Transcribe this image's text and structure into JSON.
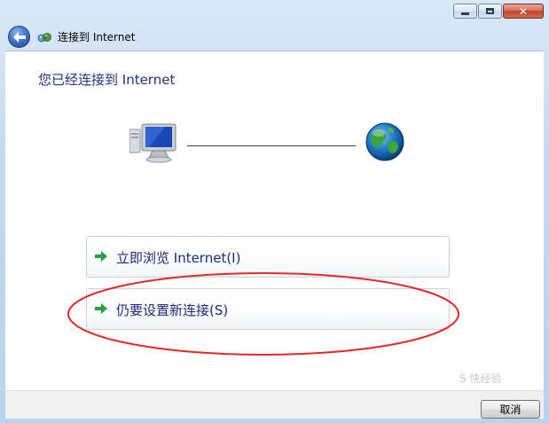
{
  "window": {
    "title": "连接到 Internet",
    "caption_buttons": [
      "minimize-icon",
      "maximize-icon",
      "close-icon"
    ]
  },
  "content": {
    "heading": "您已经连接到 Internet"
  },
  "options": [
    {
      "label": "立即浏览 Internet(I)",
      "icon": "green-arrow-icon"
    },
    {
      "label": "仍要设置新连接(S)",
      "icon": "green-arrow-icon"
    }
  ],
  "footer": {
    "cancel_label": "取消"
  },
  "annotation": {
    "color": "#e02a2a"
  },
  "watermark": {
    "text": "S 快经验"
  }
}
